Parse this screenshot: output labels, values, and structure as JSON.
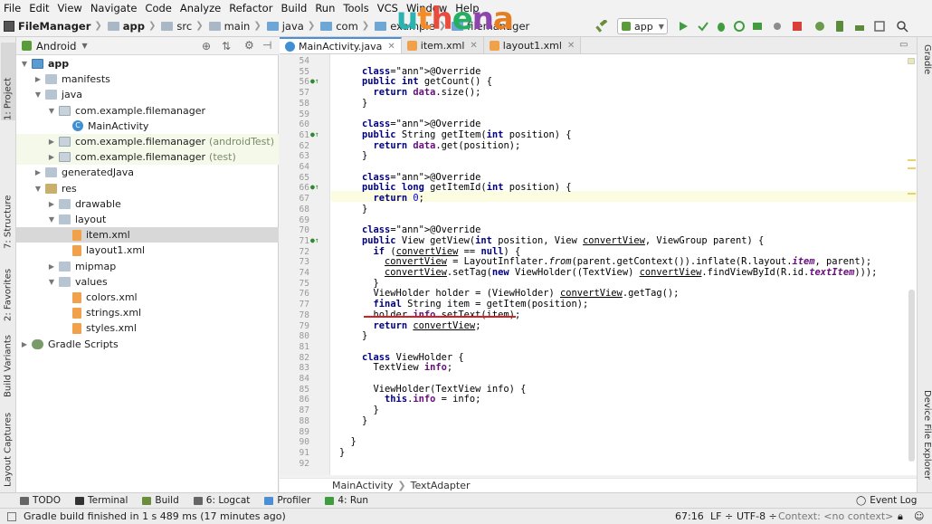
{
  "menu": [
    "File",
    "Edit",
    "View",
    "Navigate",
    "Code",
    "Analyze",
    "Refactor",
    "Build",
    "Run",
    "Tools",
    "VCS",
    "Window",
    "Help"
  ],
  "breadcrumb": {
    "project": "FileManager",
    "items": [
      "app",
      "src",
      "main",
      "java",
      "com",
      "example",
      "filemanager"
    ]
  },
  "watermark": "uthena",
  "run_config": "app",
  "project_panel": {
    "view_mode": "Android",
    "tree": [
      {
        "label": "app",
        "suffix": "",
        "indent": 0,
        "arrow": "▼",
        "icon": "mod",
        "bold": true
      },
      {
        "label": "manifests",
        "suffix": "",
        "indent": 1,
        "arrow": "▶",
        "icon": "folder"
      },
      {
        "label": "java",
        "suffix": "",
        "indent": 1,
        "arrow": "▼",
        "icon": "folder"
      },
      {
        "label": "com.example.filemanager",
        "suffix": "",
        "indent": 2,
        "arrow": "▼",
        "icon": "pkg"
      },
      {
        "label": "MainActivity",
        "suffix": "",
        "indent": 3,
        "arrow": "",
        "icon": "cls"
      },
      {
        "label": "com.example.filemanager",
        "suffix": "(androidTest)",
        "indent": 2,
        "arrow": "▶",
        "icon": "pkg",
        "test": true
      },
      {
        "label": "com.example.filemanager",
        "suffix": "(test)",
        "indent": 2,
        "arrow": "▶",
        "icon": "pkg",
        "test": true
      },
      {
        "label": "generatedJava",
        "suffix": "",
        "indent": 1,
        "arrow": "▶",
        "icon": "folder"
      },
      {
        "label": "res",
        "suffix": "",
        "indent": 1,
        "arrow": "▼",
        "icon": "res"
      },
      {
        "label": "drawable",
        "suffix": "",
        "indent": 2,
        "arrow": "▶",
        "icon": "folder"
      },
      {
        "label": "layout",
        "suffix": "",
        "indent": 2,
        "arrow": "▼",
        "icon": "folder"
      },
      {
        "label": "item.xml",
        "suffix": "",
        "indent": 3,
        "arrow": "",
        "icon": "xml",
        "selected": true
      },
      {
        "label": "layout1.xml",
        "suffix": "",
        "indent": 3,
        "arrow": "",
        "icon": "xml"
      },
      {
        "label": "mipmap",
        "suffix": "",
        "indent": 2,
        "arrow": "▶",
        "icon": "folder"
      },
      {
        "label": "values",
        "suffix": "",
        "indent": 2,
        "arrow": "▼",
        "icon": "folder"
      },
      {
        "label": "colors.xml",
        "suffix": "",
        "indent": 3,
        "arrow": "",
        "icon": "xml"
      },
      {
        "label": "strings.xml",
        "suffix": "",
        "indent": 3,
        "arrow": "",
        "icon": "xml"
      },
      {
        "label": "styles.xml",
        "suffix": "",
        "indent": 3,
        "arrow": "",
        "icon": "xml"
      },
      {
        "label": "Gradle Scripts",
        "suffix": "",
        "indent": 0,
        "arrow": "▶",
        "icon": "gradle"
      }
    ]
  },
  "left_tabs": [
    "1: Project",
    "7: Structure",
    "2: Favorites",
    "Build Variants",
    "Layout Captures"
  ],
  "right_tabs": [
    "Gradle",
    "Device File Explorer"
  ],
  "editor_tabs": [
    {
      "label": "MainActivity.java",
      "active": true
    },
    {
      "label": "item.xml",
      "active": false
    },
    {
      "label": "layout1.xml",
      "active": false
    }
  ],
  "editor": {
    "line_numbers": [
      "54",
      "55",
      "56",
      "57",
      "58",
      "59",
      "60",
      "61",
      "62",
      "63",
      "64",
      "65",
      "66",
      "67",
      "68",
      "69",
      "70",
      "71",
      "72",
      "73",
      "74",
      "75",
      "76",
      "77",
      "78",
      "79",
      "80",
      "81",
      "82",
      "83",
      "84",
      "85",
      "86",
      "87",
      "88",
      "89",
      "90",
      "91",
      "92"
    ],
    "override_lines": [
      "56",
      "61",
      "66",
      "71"
    ],
    "code": [
      "",
      "    @Override",
      "    public int getCount() {",
      "      return data.size();",
      "    }",
      "",
      "    @Override",
      "    public String getItem(int position) {",
      "      return data.get(position);",
      "    }",
      "",
      "    @Override",
      "    public long getItemId(int position) {",
      "      return 0;",
      "    }",
      "",
      "    @Override",
      "    public View getView(int position, View convertView, ViewGroup parent) {",
      "      if (convertView == null) {",
      "        convertView = LayoutInflater.from(parent.getContext()).inflate(R.layout.item, parent);",
      "        convertView.setTag(new ViewHolder((TextView) convertView.findViewById(R.id.textItem)));",
      "      }",
      "      ViewHolder holder = (ViewHolder) convertView.getTag();",
      "      final String item = getItem(position);",
      "      holder.info.setText(item);",
      "      return convertView;",
      "    }",
      "",
      "    class ViewHolder {",
      "      TextView info;",
      "",
      "      ViewHolder(TextView info) {",
      "        this.info = info;",
      "      }",
      "    }",
      "",
      "  }",
      "}",
      ""
    ]
  },
  "editor_breadcrumb": [
    "MainActivity",
    "TextAdapter"
  ],
  "tool_tabs": [
    "TODO",
    "Terminal",
    "Build",
    "6: Logcat",
    "Profiler",
    "4: Run"
  ],
  "event_log": "Event Log",
  "status": {
    "message": "Gradle build finished in 1 s 489 ms (17 minutes ago)",
    "position": "67:16",
    "line_sep": "LF ÷",
    "encoding": "UTF-8 ÷",
    "context": "Context: <no context>"
  }
}
